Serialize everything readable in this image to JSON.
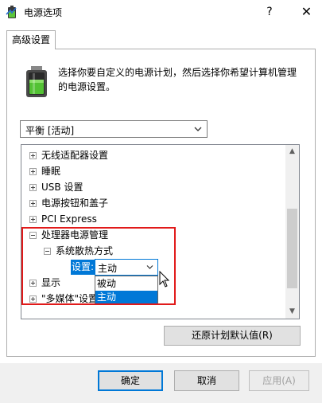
{
  "window": {
    "title": "电源选项",
    "help": "?",
    "close": "✕"
  },
  "tab": {
    "label": "高级设置"
  },
  "description": "选择你要自定义的电源计划，然后选择你希望计算机管理的电源设置。",
  "plan_select": {
    "value": "平衡 [活动]"
  },
  "tree": {
    "items": [
      {
        "label": "无线适配器设置",
        "state": "collapsed"
      },
      {
        "label": "睡眠",
        "state": "collapsed"
      },
      {
        "label": "USB 设置",
        "state": "collapsed"
      },
      {
        "label": "电源按钮和盖子",
        "state": "collapsed"
      },
      {
        "label": "PCI Express",
        "state": "collapsed"
      },
      {
        "label": "处理器电源管理",
        "state": "expanded"
      },
      {
        "label": "系统散热方式",
        "state": "expanded"
      },
      {
        "label": "显示",
        "state": "collapsed"
      },
      {
        "label": "\"多媒体\"设置",
        "state": "collapsed"
      }
    ],
    "setting": {
      "label": "设置:",
      "value": "主动",
      "options": [
        "被动",
        "主动"
      ],
      "selected": "主动"
    }
  },
  "buttons": {
    "restore": "还原计划默认值(R)",
    "ok": "确定",
    "cancel": "取消",
    "apply": "应用(A)"
  },
  "colors": {
    "accent": "#0078d7",
    "highlight": "#e11a1a"
  }
}
